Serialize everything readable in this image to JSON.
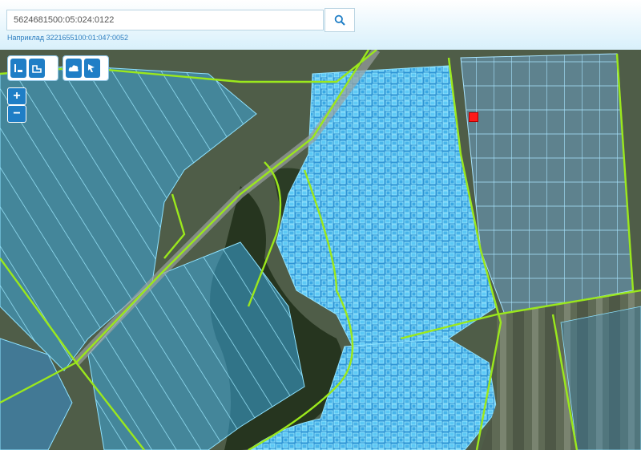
{
  "search": {
    "value": "5624681500:05:024:0122",
    "button": "search-icon"
  },
  "hint": {
    "text": "Наприклад 3221655100:01:047:0052"
  },
  "toolbar": {
    "group1": [
      "layer-plot-icon",
      "layer-boundary-icon"
    ],
    "group2": [
      "cloud-icon",
      "cursor-icon"
    ]
  },
  "zoom": {
    "in": "+",
    "out": "−"
  },
  "colors": {
    "parcel_fill": "#3ab4f0",
    "parcel_stroke": "#8ee2ff",
    "boundary": "#9be81c",
    "marker": "#ff1a1a",
    "accent": "#1f7ec6"
  },
  "map": {
    "layer": "satellite",
    "overlay": "cadastral-parcels",
    "selected_parcel": "5624681500:05:024:0122"
  }
}
